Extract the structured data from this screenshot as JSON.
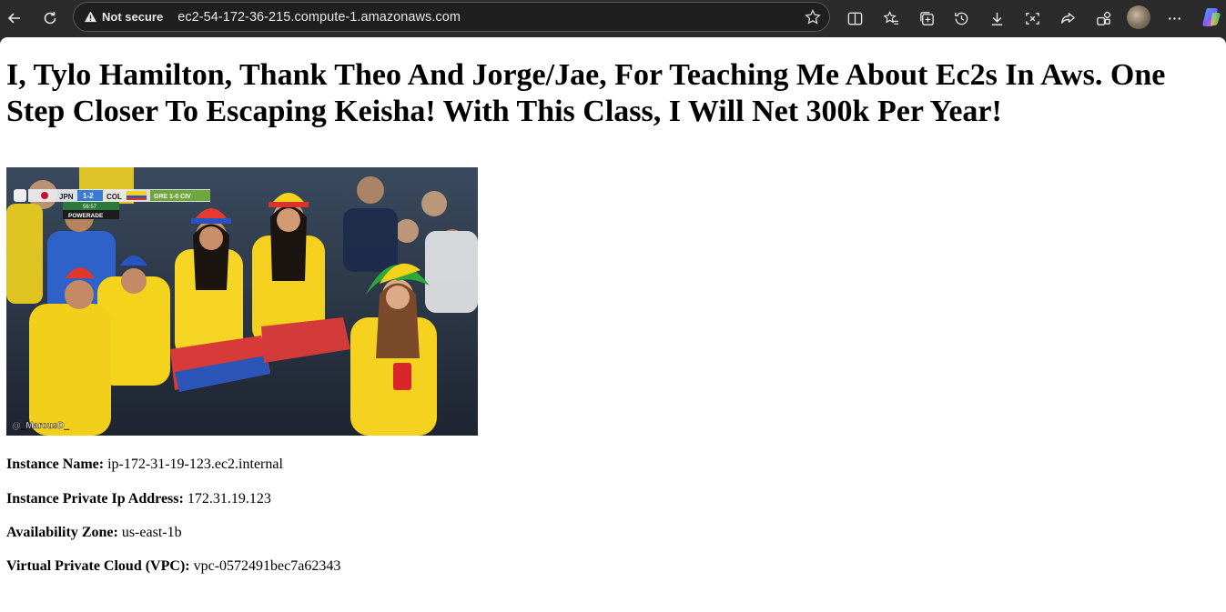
{
  "browser": {
    "security_label": "Not secure",
    "url": "ec2-54-172-36-215.compute-1.amazonaws.com"
  },
  "page": {
    "heading": "I, Tylo Hamilton, Thank Theo And Jorge/Jae, For Teaching Me About Ec2s In Aws. One Step Closer To Escaping Keisha! With This Class, I Will Net 300k Per Year!",
    "image": {
      "watermark": "@_MarcusD_",
      "scoreboard": {
        "team_a": "JPN",
        "score": "1-2",
        "team_b": "COL",
        "clock": "56:57",
        "sponsor": "POWERADE",
        "other_match": "GRE 1-0 CIV"
      }
    },
    "details": [
      {
        "label": "Instance Name:",
        "value": "ip-172-31-19-123.ec2.internal"
      },
      {
        "label": "Instance Private Ip Address:",
        "value": "172.31.19.123"
      },
      {
        "label": "Availability Zone:",
        "value": "us-east-1b"
      },
      {
        "label": "Virtual Private Cloud (VPC):",
        "value": "vpc-0572491bec7a62343"
      }
    ]
  },
  "colors": {
    "chrome_bg": "#2b2b2b",
    "page_bg": "#ffffff",
    "text": "#000000"
  }
}
